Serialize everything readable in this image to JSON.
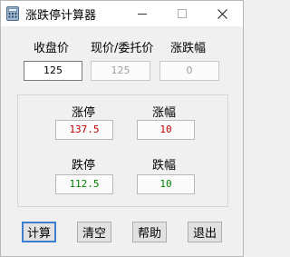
{
  "window": {
    "title": "涨跌停计算器"
  },
  "inputs": {
    "close_label": "收盘价",
    "close_value": "125",
    "current_label": "现价/委托价",
    "current_value": "125",
    "change_label": "涨跌幅",
    "change_value": "0"
  },
  "results": {
    "limit_up_label": "涨停",
    "limit_up_value": "137.5",
    "up_pct_label": "涨幅",
    "up_pct_value": "10",
    "limit_down_label": "跌停",
    "limit_down_value": "112.5",
    "down_pct_label": "跌幅",
    "down_pct_value": "10"
  },
  "buttons": {
    "calc": "计算",
    "clear": "清空",
    "help": "帮助",
    "exit": "退出"
  },
  "colors": {
    "up": "#c00000",
    "down": "#008000",
    "accent": "#3c7fd1"
  }
}
